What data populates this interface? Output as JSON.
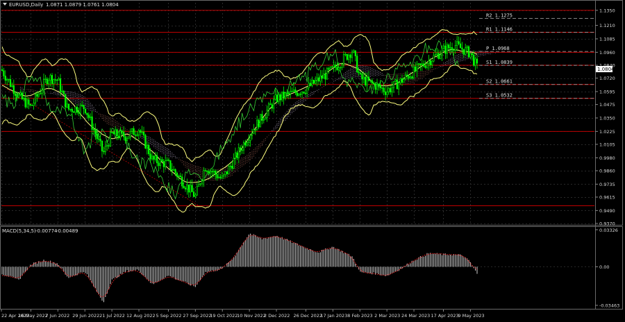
{
  "header": {
    "symbol": "EURUSD,Daily",
    "ohlc": "1.0871 1.0879 1.0761 1.0804"
  },
  "macd": {
    "label": "MACD(5,34,5)",
    "value_main": "-0.00774",
    "value_signal": "-0.00489"
  },
  "current_price": "1.0804",
  "colors": {
    "background": "#000000",
    "candle": "#00ff00",
    "bollinger": "#ffff80",
    "chikou": "#32cd32",
    "level_line": "#c00000",
    "macd_hist": "#c0c0c0",
    "macd_signal": "#ff2020",
    "cloud_bull": "#b0a0c0",
    "cloud_bear": "#a06050"
  },
  "pivot_levels": [
    {
      "name": "R2",
      "value": "1.1275"
    },
    {
      "name": "R1",
      "value": "1.1146"
    },
    {
      "name": "P",
      "value": "1.0968"
    },
    {
      "name": "S1",
      "value": "1.0839"
    },
    {
      "name": "S2",
      "value": "1.0661"
    },
    {
      "name": "S3",
      "value": "1.0532"
    }
  ],
  "chart_data": [
    {
      "type": "candlestick",
      "title": "EURUSD,Daily",
      "ylim": [
        0.937,
        1.142
      ],
      "price_ticks": [
        "1.1350",
        "1.1210",
        "1.1085",
        "1.0960",
        "1.0840",
        "1.0720",
        "1.0595",
        "1.0475",
        "1.0350",
        "1.0225",
        "1.0105",
        "0.9980",
        "0.9860",
        "0.9735",
        "0.9615",
        "0.9490",
        "0.9370"
      ],
      "date_ticks": [
        "22 Apr 2022",
        "16 May 2022",
        "7 Jun 2022",
        "29 Jun 2022",
        "21 Jul 2022",
        "12 Aug 2022",
        "5 Sep 2022",
        "27 Sep 2022",
        "19 Oct 2022",
        "10 Nov 2022",
        "2 Dec 2022",
        "26 Dec 2022",
        "17 Jan 2023",
        "8 Feb 2023",
        "2 Mar 2023",
        "24 Mar 2023",
        "17 Apr 2023",
        "9 May 2023"
      ],
      "horizontal_levels": [
        1.135,
        1.1146,
        1.096,
        1.084,
        1.0661,
        1.0532,
        1.0225,
        0.9534
      ],
      "price_path": [
        {
          "date": "22 Apr 2022",
          "close": 1.08
        },
        {
          "date": "6 May 2022",
          "close": 1.055
        },
        {
          "date": "16 May 2022",
          "close": 1.045
        },
        {
          "date": "30 May 2022",
          "close": 1.073
        },
        {
          "date": "7 Jun 2022",
          "close": 1.07
        },
        {
          "date": "15 Jun 2022",
          "close": 1.043
        },
        {
          "date": "29 Jun 2022",
          "close": 1.045
        },
        {
          "date": "14 Jul 2022",
          "close": 1.002
        },
        {
          "date": "21 Jul 2022",
          "close": 1.02
        },
        {
          "date": "2 Aug 2022",
          "close": 1.018
        },
        {
          "date": "12 Aug 2022",
          "close": 1.025
        },
        {
          "date": "23 Aug 2022",
          "close": 0.996
        },
        {
          "date": "5 Sep 2022",
          "close": 0.992
        },
        {
          "date": "27 Sep 2022",
          "close": 0.962
        },
        {
          "date": "5 Oct 2022",
          "close": 0.99
        },
        {
          "date": "19 Oct 2022",
          "close": 0.978
        },
        {
          "date": "28 Oct 2022",
          "close": 0.995
        },
        {
          "date": "10 Nov 2022",
          "close": 1.02
        },
        {
          "date": "2 Dec 2022",
          "close": 1.053
        },
        {
          "date": "26 Dec 2022",
          "close": 1.062
        },
        {
          "date": "17 Jan 2023",
          "close": 1.08
        },
        {
          "date": "2 Feb 2023",
          "close": 1.098
        },
        {
          "date": "8 Feb 2023",
          "close": 1.072
        },
        {
          "date": "2 Mar 2023",
          "close": 1.06
        },
        {
          "date": "24 Mar 2023",
          "close": 1.078
        },
        {
          "date": "17 Apr 2023",
          "close": 1.098
        },
        {
          "date": "26 Apr 2023",
          "close": 1.103
        },
        {
          "date": "9 May 2023",
          "close": 1.095
        },
        {
          "date": "15 May 2023",
          "close": 1.0804
        }
      ]
    },
    {
      "type": "bar",
      "title": "MACD(5,34,5)",
      "ylim": [
        -0.03463,
        0.03326
      ],
      "y_ticks": [
        "0.03326",
        "0.00",
        "-0.03463"
      ],
      "histogram": [
        {
          "date": "22 Apr 2022",
          "value": -0.006
        },
        {
          "date": "6 May 2022",
          "value": -0.012
        },
        {
          "date": "16 May 2022",
          "value": 0.002
        },
        {
          "date": "27 May 2022",
          "value": 0.006
        },
        {
          "date": "7 Jun 2022",
          "value": 0.003
        },
        {
          "date": "15 Jun 2022",
          "value": -0.01
        },
        {
          "date": "29 Jun 2022",
          "value": -0.004
        },
        {
          "date": "14 Jul 2022",
          "value": -0.032
        },
        {
          "date": "21 Jul 2022",
          "value": -0.012
        },
        {
          "date": "2 Aug 2022",
          "value": -0.004
        },
        {
          "date": "12 Aug 2022",
          "value": -0.003
        },
        {
          "date": "23 Aug 2022",
          "value": -0.016
        },
        {
          "date": "5 Sep 2022",
          "value": -0.008
        },
        {
          "date": "27 Sep 2022",
          "value": -0.018
        },
        {
          "date": "5 Oct 2022",
          "value": -0.005
        },
        {
          "date": "19 Oct 2022",
          "value": -0.002
        },
        {
          "date": "28 Oct 2022",
          "value": 0.008
        },
        {
          "date": "10 Nov 2022",
          "value": 0.03
        },
        {
          "date": "20 Nov 2022",
          "value": 0.025
        },
        {
          "date": "2 Dec 2022",
          "value": 0.028
        },
        {
          "date": "15 Dec 2022",
          "value": 0.022
        },
        {
          "date": "26 Dec 2022",
          "value": 0.017
        },
        {
          "date": "5 Jan 2023",
          "value": 0.013
        },
        {
          "date": "17 Jan 2023",
          "value": 0.018
        },
        {
          "date": "2 Feb 2023",
          "value": 0.009
        },
        {
          "date": "8 Feb 2023",
          "value": -0.005
        },
        {
          "date": "20 Feb 2023",
          "value": -0.006
        },
        {
          "date": "2 Mar 2023",
          "value": -0.008
        },
        {
          "date": "13 Mar 2023",
          "value": -0.002
        },
        {
          "date": "24 Mar 2023",
          "value": 0.006
        },
        {
          "date": "5 Apr 2023",
          "value": 0.012
        },
        {
          "date": "17 Apr 2023",
          "value": 0.011
        },
        {
          "date": "26 Apr 2023",
          "value": 0.011
        },
        {
          "date": "3 May 2023",
          "value": 0.01
        },
        {
          "date": "9 May 2023",
          "value": 0.004
        },
        {
          "date": "15 May 2023",
          "value": -0.00774
        }
      ]
    }
  ]
}
